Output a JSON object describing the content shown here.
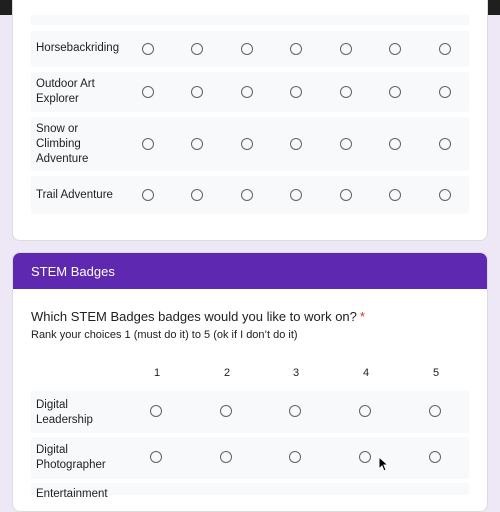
{
  "card1": {
    "rows": [
      {
        "label": "Horsebackriding"
      },
      {
        "label": "Outdoor Art Explorer"
      },
      {
        "label": "Snow or Climbing Adventure"
      },
      {
        "label": "Trail Adventure"
      }
    ]
  },
  "stem": {
    "header": "STEM Badges",
    "question": "Which STEM Badges badges would you like to work on?",
    "required_mark": "*",
    "subtext": "Rank your choices 1 (must do it) to 5 (ok if I don’t do it)",
    "columns": [
      "1",
      "2",
      "3",
      "4",
      "5"
    ],
    "rows": [
      {
        "label": "Digital Leadership"
      },
      {
        "label": "Digital Photographer"
      },
      {
        "label": "Entertainment"
      }
    ]
  },
  "colors": {
    "header_purple": "#5e29b0",
    "page_background": "#ede7f6",
    "required": "#d93025"
  }
}
